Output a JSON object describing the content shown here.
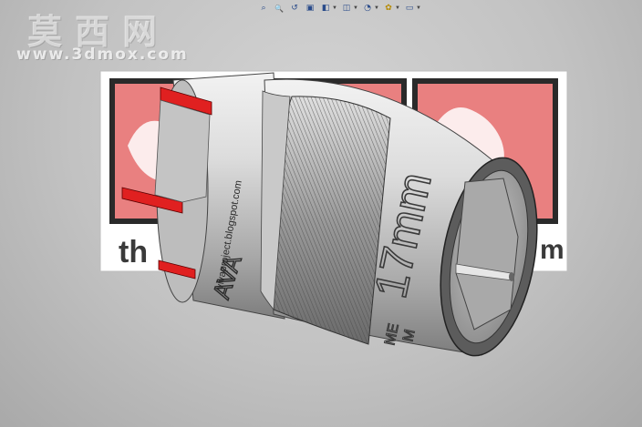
{
  "toolbar": {
    "buttons": [
      {
        "icon": "zoom-to-fit-icon",
        "glyph": "⌕"
      },
      {
        "icon": "zoom-area-icon",
        "glyph": "🔍"
      },
      {
        "icon": "previous-view-icon",
        "glyph": "↺"
      },
      {
        "icon": "section-view-icon",
        "glyph": "▣"
      },
      {
        "icon": "view-orientation-icon",
        "glyph": "◧"
      },
      {
        "icon": "display-style-icon",
        "glyph": "◫"
      },
      {
        "icon": "hide-show-items-icon",
        "glyph": "◔"
      },
      {
        "icon": "edit-appearance-icon",
        "glyph": "✿"
      },
      {
        "icon": "apply-scene-icon",
        "glyph": "▭"
      }
    ]
  },
  "watermark": {
    "title": "莫西网",
    "url": "www.3dmox.com"
  },
  "background_logo": {
    "text_left": "th",
    "text_right": "m"
  },
  "model": {
    "size_label": "17mm",
    "brand_mark": "AVA",
    "website": "vivaproject.blogspot.com",
    "side_text_1": "ME",
    "side_text_2": "M"
  },
  "colors": {
    "accent_red": "#e02020",
    "logo_panel": "#e98080",
    "socket_base": "#c9c9c9"
  }
}
